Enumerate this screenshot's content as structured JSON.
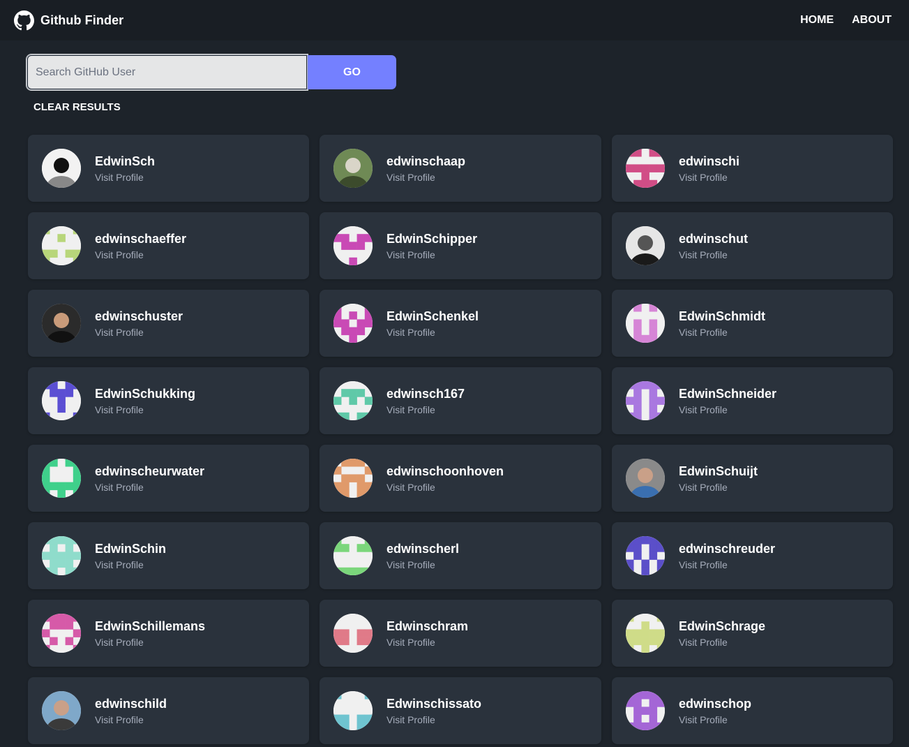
{
  "header": {
    "title": "Github Finder",
    "brand_icon": "github-icon",
    "nav": [
      {
        "label": "HOME"
      },
      {
        "label": "ABOUT"
      }
    ]
  },
  "search": {
    "placeholder": "Search GitHub User",
    "value": "",
    "go_label": "GO",
    "clear_label": "CLEAR RESULTS",
    "accent_color": "#7480ff"
  },
  "results": [
    {
      "login": "EdwinSch",
      "link": "Visit Profile",
      "avatar": {
        "kind": "photo",
        "colors": [
          "#f2f2f2",
          "#111111",
          "#888888"
        ]
      }
    },
    {
      "login": "edwinschaap",
      "link": "Visit Profile",
      "avatar": {
        "kind": "photo",
        "colors": [
          "#6f8a55",
          "#d9d5c8",
          "#3c4b2c"
        ]
      }
    },
    {
      "login": "edwinschi",
      "link": "Visit Profile",
      "avatar": {
        "kind": "identicon",
        "color": "#d14d86"
      }
    },
    {
      "login": "edwinschaeffer",
      "link": "Visit Profile",
      "avatar": {
        "kind": "identicon",
        "color": "#b8d67a"
      }
    },
    {
      "login": "EdwinSchipper",
      "link": "Visit Profile",
      "avatar": {
        "kind": "identicon",
        "color": "#c94ab5"
      }
    },
    {
      "login": "edwinschut",
      "link": "Visit Profile",
      "avatar": {
        "kind": "photo",
        "colors": [
          "#e6e6e6",
          "#555555",
          "#1a1a1a"
        ]
      }
    },
    {
      "login": "edwinschuster",
      "link": "Visit Profile",
      "avatar": {
        "kind": "photo",
        "colors": [
          "#2b2b2b",
          "#c99b7a",
          "#111111"
        ]
      }
    },
    {
      "login": "EdwinSchenkel",
      "link": "Visit Profile",
      "avatar": {
        "kind": "identicon",
        "color": "#c94ab5"
      }
    },
    {
      "login": "EdwinSchmidt",
      "link": "Visit Profile",
      "avatar": {
        "kind": "identicon",
        "color": "#d685d6"
      }
    },
    {
      "login": "EdwinSchukking",
      "link": "Visit Profile",
      "avatar": {
        "kind": "identicon",
        "color": "#5b4fd3"
      }
    },
    {
      "login": "edwinsch167",
      "link": "Visit Profile",
      "avatar": {
        "kind": "identicon",
        "color": "#5fc9a8"
      }
    },
    {
      "login": "EdwinSchneider",
      "link": "Visit Profile",
      "avatar": {
        "kind": "identicon",
        "color": "#a978e0"
      }
    },
    {
      "login": "edwinscheurwater",
      "link": "Visit Profile",
      "avatar": {
        "kind": "identicon",
        "color": "#3fd08b"
      }
    },
    {
      "login": "edwinschoonhoven",
      "link": "Visit Profile",
      "avatar": {
        "kind": "identicon",
        "color": "#e09a6a"
      }
    },
    {
      "login": "EdwinSchuijt",
      "link": "Visit Profile",
      "avatar": {
        "kind": "photo",
        "colors": [
          "#8a8a8a",
          "#c9a088",
          "#3a6fb0"
        ]
      }
    },
    {
      "login": "EdwinSchin",
      "link": "Visit Profile",
      "avatar": {
        "kind": "identicon",
        "color": "#8fdccb"
      }
    },
    {
      "login": "edwinscherl",
      "link": "Visit Profile",
      "avatar": {
        "kind": "identicon",
        "color": "#7bd67b"
      }
    },
    {
      "login": "edwinschreuder",
      "link": "Visit Profile",
      "avatar": {
        "kind": "identicon",
        "color": "#5b4fc9"
      }
    },
    {
      "login": "EdwinSchillemans",
      "link": "Visit Profile",
      "avatar": {
        "kind": "identicon",
        "color": "#d65aa8"
      }
    },
    {
      "login": "Edwinschram",
      "link": "Visit Profile",
      "avatar": {
        "kind": "identicon",
        "color": "#e07a88"
      }
    },
    {
      "login": "EdwinSchrage",
      "link": "Visit Profile",
      "avatar": {
        "kind": "identicon",
        "color": "#cfdc88"
      }
    },
    {
      "login": "edwinschild",
      "link": "Visit Profile",
      "avatar": {
        "kind": "photo",
        "colors": [
          "#7fa8c9",
          "#c9a088",
          "#3a3a3a"
        ]
      }
    },
    {
      "login": "Edwinschissato",
      "link": "Visit Profile",
      "avatar": {
        "kind": "identicon",
        "color": "#6fc4d0"
      }
    },
    {
      "login": "edwinschop",
      "link": "Visit Profile",
      "avatar": {
        "kind": "identicon",
        "color": "#a466d6"
      }
    }
  ]
}
